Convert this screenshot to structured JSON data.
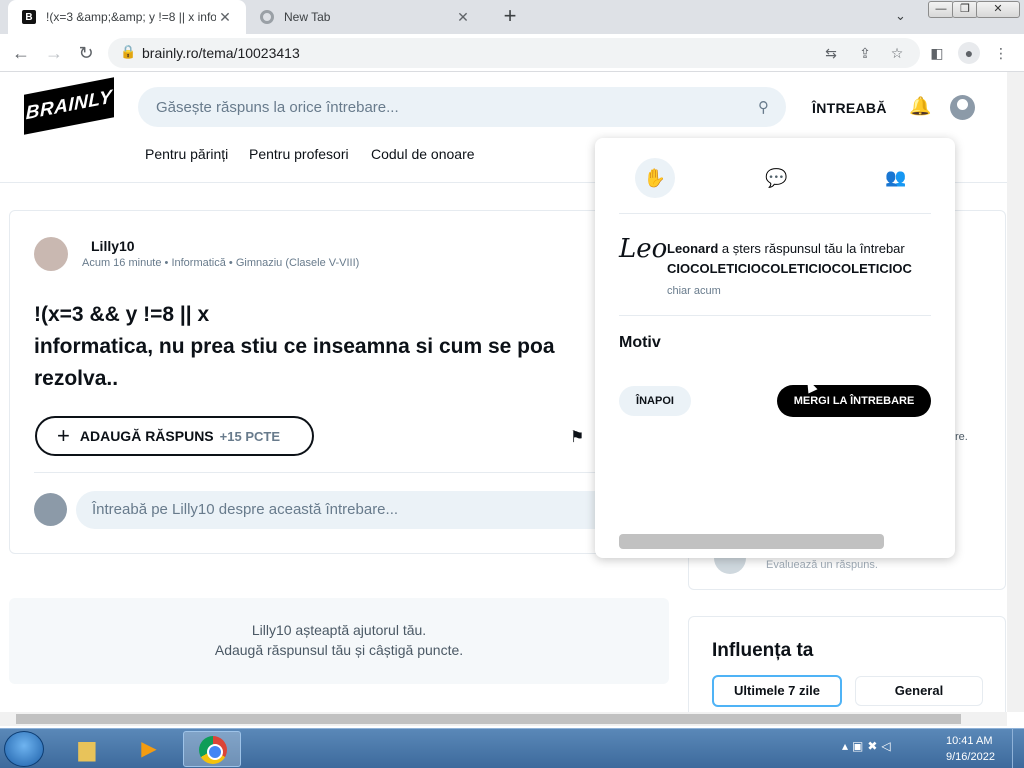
{
  "browser": {
    "tabs": [
      {
        "title": "!(x=3 &amp;&amp; y !=8 || x info",
        "favicon": "B",
        "active": true
      },
      {
        "title": "New Tab",
        "favicon": "chrome",
        "active": false
      }
    ],
    "url": "brainly.ro/tema/10023413"
  },
  "header": {
    "logo": "BRAINLY",
    "search_placeholder": "Găsește răspuns la orice întrebare...",
    "ask_label": "ÎNTREABĂ",
    "nav": [
      "Pentru părinți",
      "Pentru profesori",
      "Codul de onoare"
    ]
  },
  "question": {
    "user": "Lilly10",
    "meta": "Acum 16 minute • Informatică • Gimnaziu (Clasele V-VIII)",
    "text": "!(x=3 && y !=8 || x\ninformatica, nu prea stiu ce inseamna si cum se poa\nrezolva..",
    "add_answer_label": "ADAUGĂ RĂSPUNS",
    "points": "+15 PCTE",
    "comment_placeholder": "Întreabă pe Lilly10 despre această întrebare..."
  },
  "waiting": {
    "line1": "Lilly10 așteaptă ajutorul tău.",
    "line2": "Adaugă răspunsul tău și câștigă puncte."
  },
  "sidebar": {
    "text_fragment": "re.",
    "evaluate_text": "Evaluează un răspuns.",
    "influence_title": "Influența ta",
    "tab_7days": "Ultimele 7 zile",
    "tab_general": "General"
  },
  "notification_popup": {
    "avatar_text": "Leo",
    "actor": "Leonard",
    "action": " a șters răspunsul tău la întrebar",
    "subject": "CIOCOLETICIOCOLETICIOCOLETICIOC",
    "time": "chiar acum",
    "reason_title": "Motiv",
    "back_label": "ÎNAPOI",
    "go_label": "MERGI LA ÎNTREBARE"
  },
  "taskbar": {
    "time": "10:41 AM",
    "date": "9/16/2022"
  }
}
